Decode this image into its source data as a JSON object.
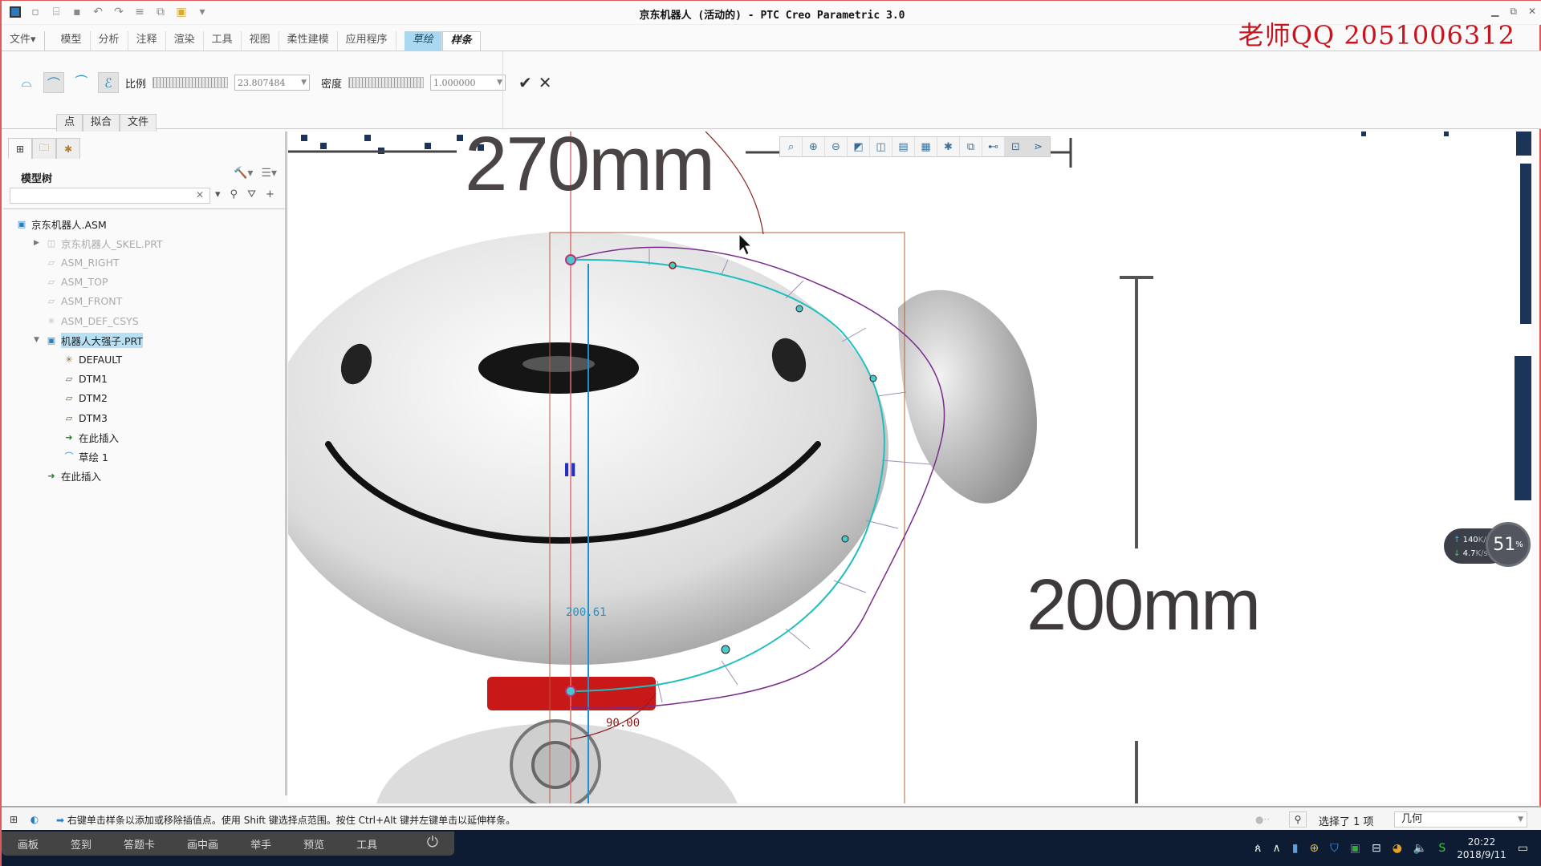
{
  "window": {
    "title": "京东机器人 (活动的) - PTC Creo Parametric 3.0",
    "watermark": "老师QQ   2051006312",
    "controls": [
      "minimize-icon",
      "restore-icon",
      "close-icon"
    ]
  },
  "quick_access": [
    "new-icon",
    "open-icon",
    "save-icon",
    "undo-icon",
    "redo-icon",
    "regenerate-icon",
    "windows-icon",
    "close-window-icon",
    "customize-icon"
  ],
  "ribbon": {
    "tabs": [
      {
        "label": "文件▾",
        "kind": "file"
      },
      {
        "label": "模型"
      },
      {
        "label": "分析"
      },
      {
        "label": "注释"
      },
      {
        "label": "渲染"
      },
      {
        "label": "工具"
      },
      {
        "label": "视图"
      },
      {
        "label": "柔性建模"
      },
      {
        "label": "应用程序"
      },
      {
        "label": "草绘",
        "kind": "sketch"
      },
      {
        "label": "样条",
        "kind": "active"
      }
    ]
  },
  "dashboard": {
    "tools": [
      "spline-dimension-icon",
      "curvature-icon",
      "control-polygon-icon",
      "curvature-analysis-icon"
    ],
    "scale_label": "比例",
    "scale_value": "23.807484",
    "density_label": "密度",
    "density_value": "1.000000",
    "ok_label": "✔",
    "cancel_label": "✕",
    "subtabs": [
      "点",
      "拟合",
      "文件"
    ]
  },
  "left_panel": {
    "tabs": [
      "model-tree-icon",
      "folder-browser-icon",
      "favorites-icon"
    ],
    "title": "模型树",
    "search_placeholder": "",
    "tree": [
      {
        "label": "京东机器人.ASM",
        "level": 0,
        "icon": "assembly-icon",
        "state": "normal"
      },
      {
        "label": "京东机器人_SKEL.PRT",
        "level": 1,
        "icon": "skeleton-icon",
        "state": "dim",
        "expandable": "collapsed"
      },
      {
        "label": "ASM_RIGHT",
        "level": 1,
        "icon": "datum-plane-icon",
        "state": "dim"
      },
      {
        "label": "ASM_TOP",
        "level": 1,
        "icon": "datum-plane-icon",
        "state": "dim"
      },
      {
        "label": "ASM_FRONT",
        "level": 1,
        "icon": "datum-plane-icon",
        "state": "dim"
      },
      {
        "label": "ASM_DEF_CSYS",
        "level": 1,
        "icon": "csys-icon",
        "state": "dim"
      },
      {
        "label": "机器人大强子.PRT",
        "level": 1,
        "icon": "part-icon",
        "state": "selected",
        "expandable": "expanded"
      },
      {
        "label": "DEFAULT",
        "level": 2,
        "icon": "csys-icon",
        "state": "normal"
      },
      {
        "label": "DTM1",
        "level": 2,
        "icon": "datum-plane-icon",
        "state": "normal"
      },
      {
        "label": "DTM2",
        "level": 2,
        "icon": "datum-plane-icon",
        "state": "normal"
      },
      {
        "label": "DTM3",
        "level": 2,
        "icon": "datum-plane-icon",
        "state": "normal"
      },
      {
        "label": "在此插入",
        "level": 2,
        "icon": "insert-here-icon",
        "state": "normal"
      },
      {
        "label": "草绘 1",
        "level": 2,
        "icon": "sketch-icon",
        "state": "normal"
      },
      {
        "label": "在此插入",
        "level": 1,
        "icon": "insert-here-icon",
        "state": "normal"
      }
    ]
  },
  "graphics_toolbar": [
    "refit-icon",
    "zoom-in-icon",
    "zoom-out-icon",
    "repaint-icon",
    "display-style-icon",
    "saved-orientations-icon",
    "view-manager-icon",
    "datum-display-icon",
    "spin-center-icon",
    "sketch-display-icon",
    "sketch-view-icon",
    "constraints-display-icon"
  ],
  "canvas": {
    "reference_labels": {
      "top": "270mm",
      "right": "200mm"
    },
    "sketch_dimensions": {
      "vertical": "200.61",
      "angle": "90.00"
    },
    "colors": {
      "spline": "#1fbfbf",
      "curvature_comb": "#7a2c8c",
      "reference": "#b86030",
      "centerline": "#1e90d0"
    }
  },
  "network_widget": {
    "upload": "140",
    "upload_unit": "K/s",
    "download": "4.7",
    "download_unit": "K/s",
    "percent": "51",
    "percent_unit": "%"
  },
  "status_bar": {
    "message": "右键单击样条以添加或移除插值点。使用 Shift 键选择点范围。按住 Ctrl+Alt 键并左键单击以延伸样条。",
    "selection": "选择了 1 项",
    "filter": "几何"
  },
  "overlay_toolbar": {
    "items": [
      "画板",
      "签到",
      "答题卡",
      "画中画",
      "举手",
      "预览",
      "工具"
    ]
  },
  "taskbar": {
    "time": "20:22",
    "date": "2018/9/11"
  }
}
